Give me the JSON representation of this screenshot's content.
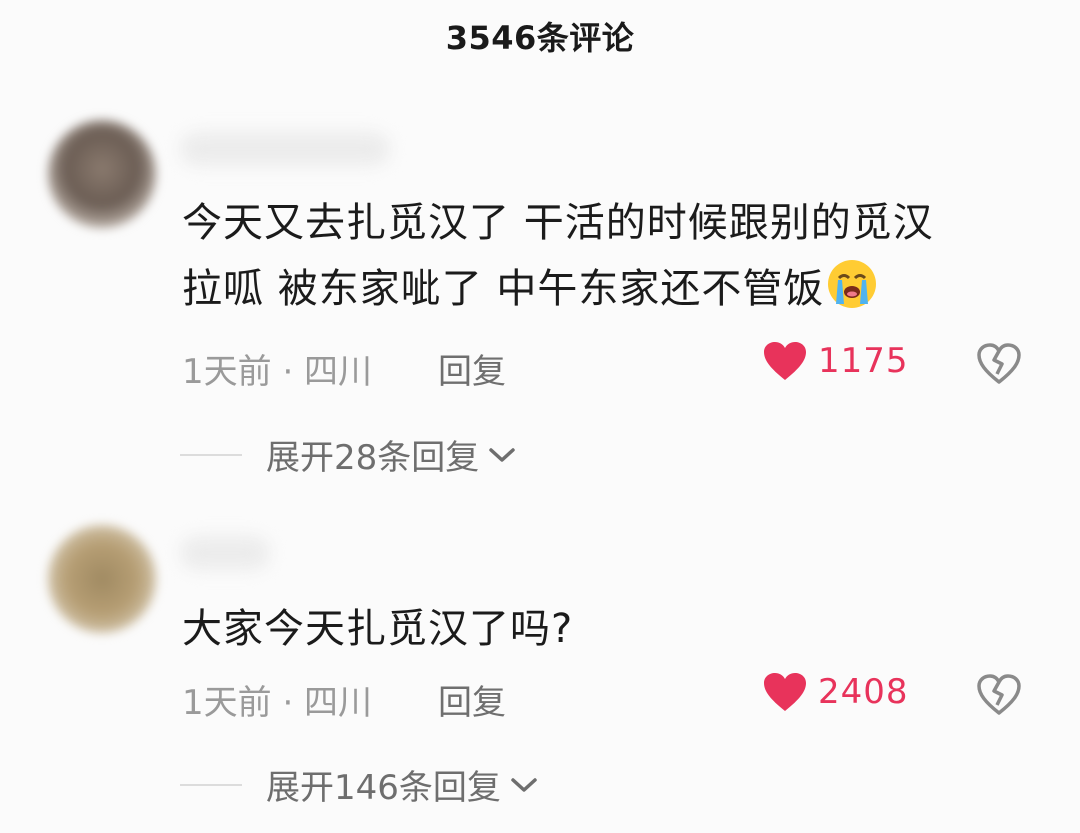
{
  "header": {
    "title": "3546条评论"
  },
  "comments": [
    {
      "text_line1": "今天又去扎觅汉了 干活的时候跟别的觅汉",
      "text_line2": "拉呱 被东家呲了 中午东家还不管饭",
      "emoji": "loudly-crying-face-emoji",
      "meta": "1天前 · 四川",
      "reply_label": "回复",
      "like_count": "1175",
      "expand_label": "展开28条回复"
    },
    {
      "text_line1": "大家今天扎觅汉了吗?",
      "meta": "1天前 · 四川",
      "reply_label": "回复",
      "like_count": "2408",
      "expand_label": "展开146条回复"
    }
  ],
  "colors": {
    "background": "#fbfbfb",
    "like_red": "#e8335b",
    "meta_gray": "#9a9a9a"
  }
}
